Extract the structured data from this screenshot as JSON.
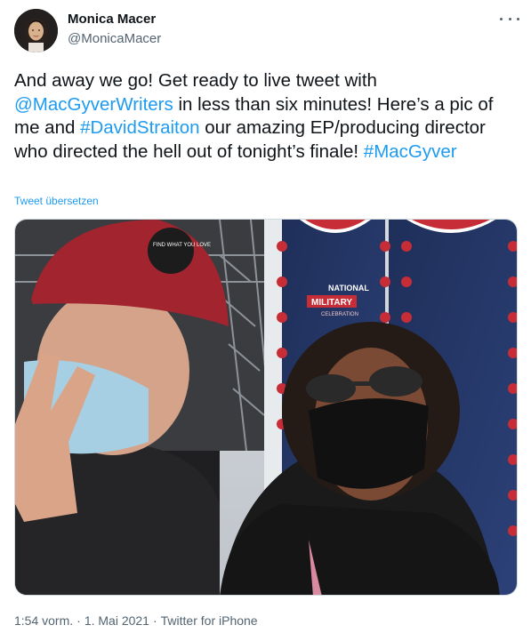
{
  "author": {
    "name": "Monica Macer",
    "handle": "@MonicaMacer"
  },
  "tweet": {
    "segments": [
      {
        "type": "text",
        "value": "And away we go! Get ready to live tweet with "
      },
      {
        "type": "mention",
        "value": "@MacGyverWriters"
      },
      {
        "type": "text",
        "value": " in less than six minutes! Here’s a pic of me and "
      },
      {
        "type": "hashtag",
        "value": "#DavidStraiton"
      },
      {
        "type": "text",
        "value": " our amazing EP/producing director who directed the hell out of tonight’s finale! "
      },
      {
        "type": "hashtag",
        "value": "#MacGyver"
      }
    ],
    "translate_label": "Tweet übersetzen"
  },
  "photo": {
    "cap_text": "FIND WHAT YOU LOVE",
    "banner_line1": "NATIONAL",
    "banner_line2": "MILITARY",
    "banner_line3": "CELEBRATION"
  },
  "meta": {
    "time": "1:54 vorm.",
    "separator": "·",
    "date": "1. Mai 2021",
    "source": "Twitter for iPhone"
  },
  "colors": {
    "accent": "#1d9bf0",
    "text": "#0f1419",
    "muted": "#536471"
  }
}
